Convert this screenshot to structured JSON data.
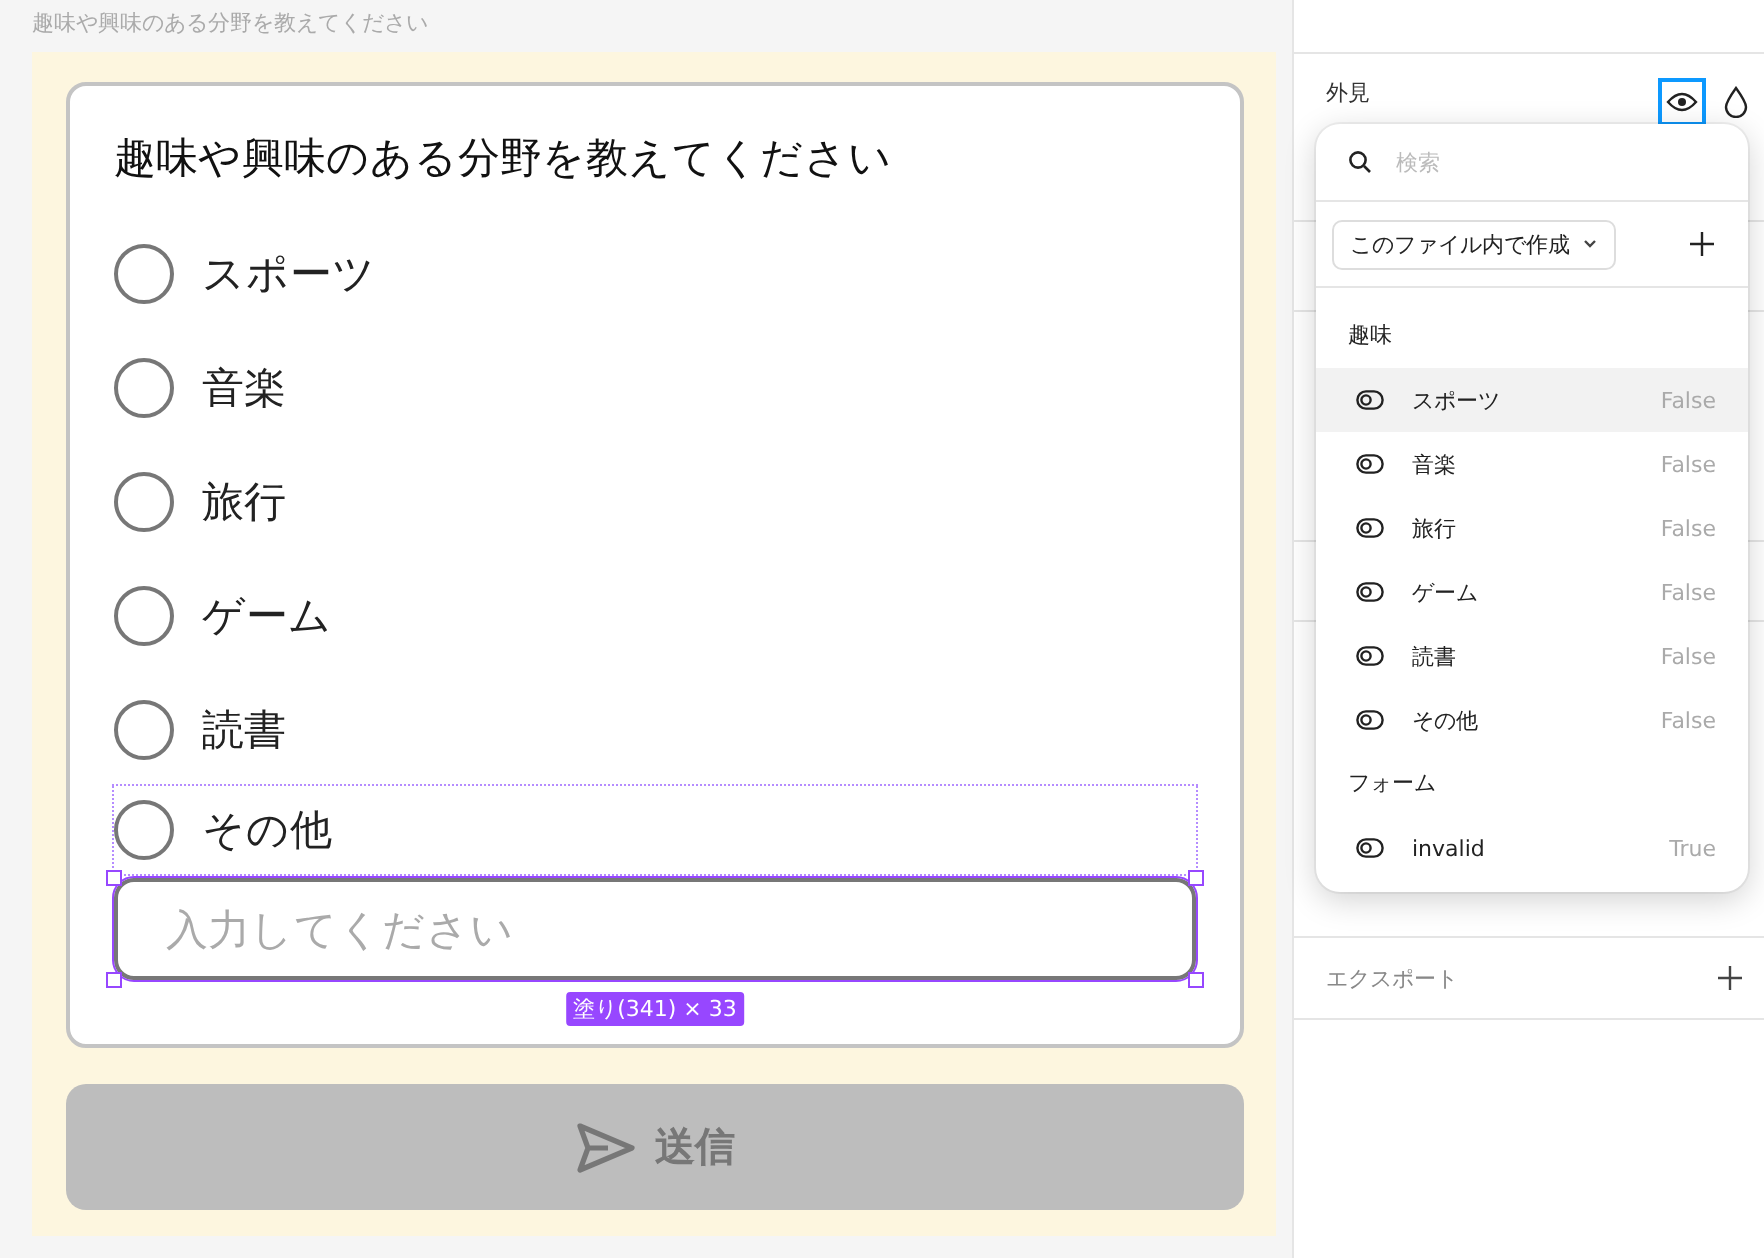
{
  "canvas": {
    "frame_label": "趣味や興味のある分野を教えてください"
  },
  "form": {
    "question": "趣味や興味のある分野を教えてください",
    "options": [
      {
        "label": "スポーツ",
        "checked": false
      },
      {
        "label": "音楽",
        "checked": false
      },
      {
        "label": "旅行",
        "checked": false
      },
      {
        "label": "ゲーム",
        "checked": false
      },
      {
        "label": "読書",
        "checked": false
      },
      {
        "label": "その他",
        "checked": false
      }
    ],
    "other_input": {
      "placeholder": "入力してください"
    },
    "selection_badge": "塗り(341) × 33",
    "submit": {
      "label": "送信",
      "disabled": true
    }
  },
  "panel": {
    "appearance": {
      "title": "外見",
      "visibility_selected": true
    },
    "sections": [
      {
        "title": "エクスポート"
      }
    ]
  },
  "variables_popup": {
    "search": {
      "placeholder": "検索"
    },
    "source_dropdown": "このファイル内で作成",
    "groups": [
      {
        "title": "趣味",
        "items": [
          {
            "name": "スポーツ",
            "value": "False",
            "selected": true
          },
          {
            "name": "音楽",
            "value": "False",
            "selected": false
          },
          {
            "name": "旅行",
            "value": "False",
            "selected": false
          },
          {
            "name": "ゲーム",
            "value": "False",
            "selected": false
          },
          {
            "name": "読書",
            "value": "False",
            "selected": false
          },
          {
            "name": "その他",
            "value": "False",
            "selected": false
          }
        ]
      },
      {
        "title": "フォーム",
        "items": [
          {
            "name": "invalid",
            "value": "True",
            "selected": false
          }
        ]
      }
    ]
  }
}
